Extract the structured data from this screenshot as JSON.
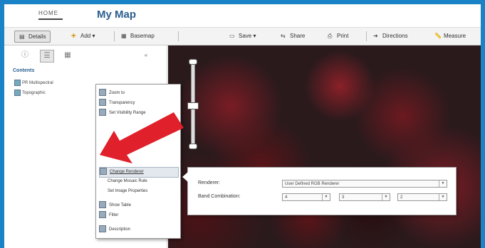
{
  "header": {
    "home_label": "HOME",
    "title": "My Map"
  },
  "toolbar": {
    "details": "Details",
    "add": "Add ▾",
    "basemap": "Basemap",
    "save": "Save ▾",
    "share": "Share",
    "print": "Print",
    "directions": "Directions",
    "measure": "Measure"
  },
  "left_pane": {
    "contents_label": "Contents",
    "layers": [
      "PR Multispectral",
      "Topographic"
    ]
  },
  "context_menu": {
    "items": [
      "Zoom to",
      "Transparency",
      "Set Visibility Range",
      "Change Renderer",
      "Change Mosaic Rule",
      "Set Image Properties",
      "Show Table",
      "Filter",
      "Description"
    ]
  },
  "renderer_panel": {
    "renderer_label": "Renderer:",
    "renderer_value": "User Defined RGB Renderer",
    "band_label": "Band Combination:",
    "band_values": [
      "4",
      "3",
      "2"
    ]
  },
  "colors": {
    "accent": "#2a5f8e",
    "frame": "#1a82c6",
    "arrow": "#e0202a"
  }
}
